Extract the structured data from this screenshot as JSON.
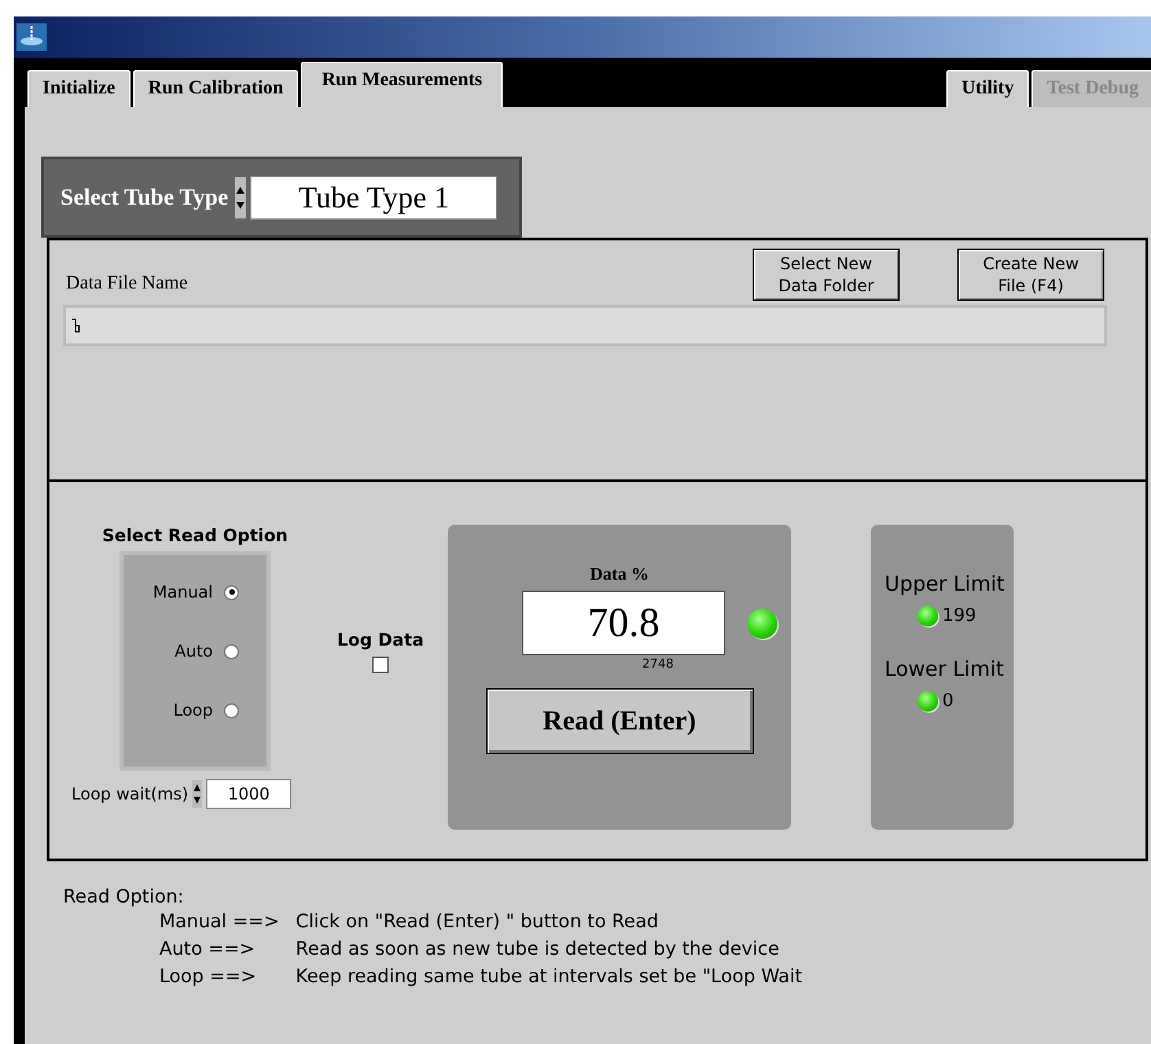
{
  "left_tabs": [
    {
      "label": "Initialize",
      "selected": false,
      "disabled": false
    },
    {
      "label": "Run Calibration",
      "selected": false,
      "disabled": false
    },
    {
      "label": "Run Measurements",
      "selected": true,
      "disabled": false
    }
  ],
  "right_tabs": [
    {
      "label": "Utility",
      "selected": false,
      "disabled": false
    },
    {
      "label": "Test Debug",
      "selected": false,
      "disabled": true
    }
  ],
  "tube_type": {
    "label": "Select Tube Type",
    "value": "Tube Type 1"
  },
  "file": {
    "label": "Data File Name",
    "buttons": [
      "Select New\nData Folder",
      "Create New\nFile (F4)"
    ]
  },
  "read_option": {
    "title": "Select Read Option",
    "options": [
      {
        "label": "Manual",
        "selected": true
      },
      {
        "label": "Auto",
        "selected": false
      },
      {
        "label": "Loop",
        "selected": false
      }
    ],
    "loop_wait_label": "Loop wait(ms)",
    "loop_wait": "1000"
  },
  "log_data": {
    "label": "Log Data",
    "checked": false
  },
  "data": {
    "label": "Data %",
    "value": "70.8",
    "raw": "2748",
    "led_on": true,
    "button": "Read (Enter)"
  },
  "limits": [
    {
      "label": "Upper Limit",
      "value": "199",
      "on": true
    },
    {
      "label": "Lower Limit",
      "value": "0",
      "on": true
    }
  ],
  "help": {
    "title": "Read Option:",
    "lines": [
      {
        "option": "Manual ==>",
        "text": "Click on \"Read (Enter) \" button to Read"
      },
      {
        "option": "Auto ==>",
        "text": "Read as soon as new tube is detected by the device"
      },
      {
        "option": "Loop ==>",
        "text": "Keep reading same tube at intervals set be \"Loop Wait"
      }
    ]
  }
}
